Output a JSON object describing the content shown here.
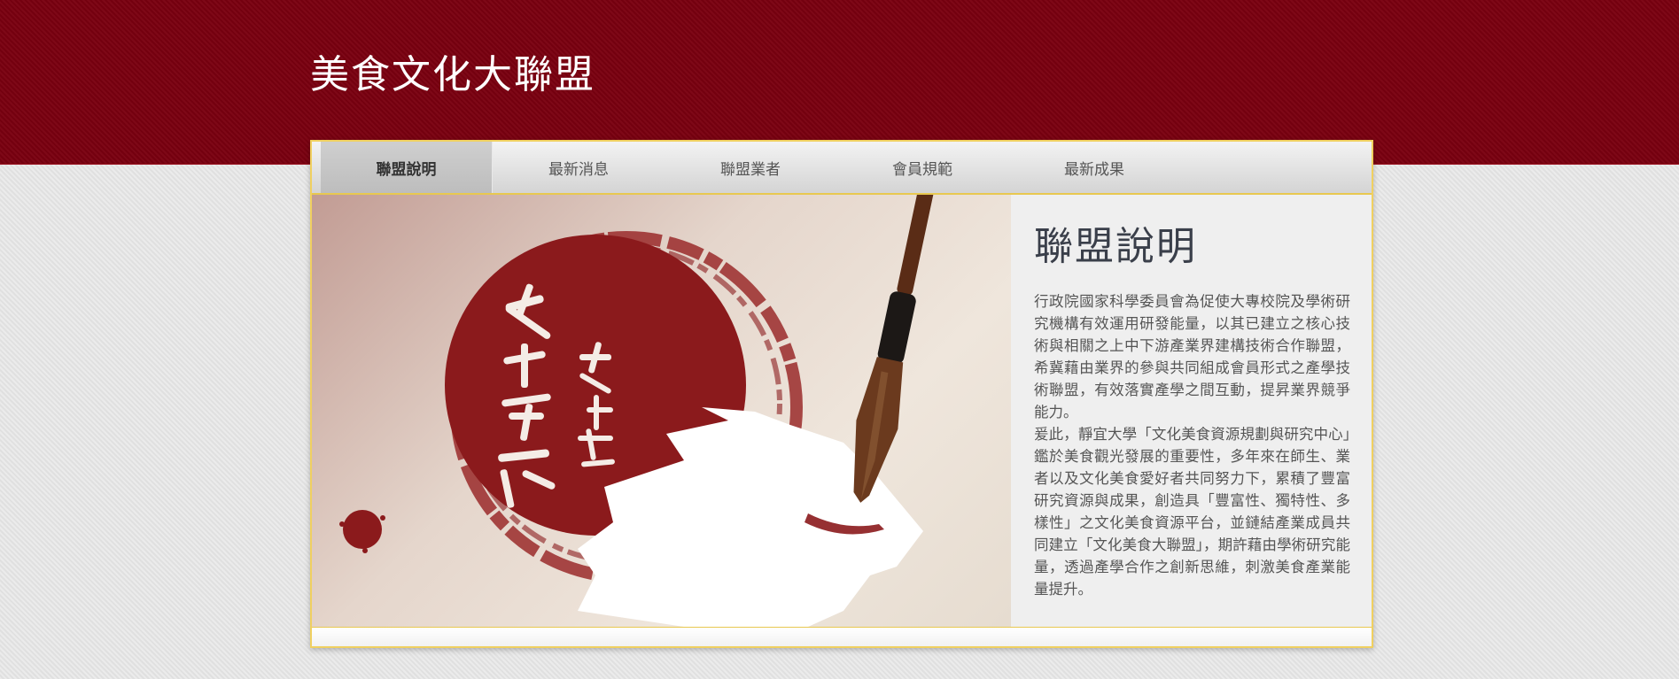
{
  "header": {
    "site_title": "美食文化大聯盟"
  },
  "nav": {
    "items": [
      {
        "label": "聯盟說明",
        "active": true
      },
      {
        "label": "最新消息",
        "active": false
      },
      {
        "label": "聯盟業者",
        "active": false
      },
      {
        "label": "會員規範",
        "active": false
      },
      {
        "label": "最新成果",
        "active": false
      }
    ]
  },
  "banner": {
    "calligraphy_text": "文化美食大聯盟",
    "colors": {
      "ink_red": "#8b1a1c",
      "paper": "#ece2d6"
    }
  },
  "content": {
    "heading": "聯盟說明",
    "paragraphs": [
      "行政院國家科學委員會為促使大專校院及學術研究機構有效運用研發能量，以其已建立之核心技術與相關之上中下游產業界建構技術合作聯盟，希冀藉由業界的參與共同組成會員形式之產學技術聯盟，有效落實產學之間互動，提昇業界競爭能力。",
      "爰此，靜宜大學「文化美食資源規劃與研究中心」鑑於美食觀光發展的重要性，多年來在師生、業者以及文化美食愛好者共同努力下，累積了豐富研究資源與成果，創造具「豐富性、獨特性、多樣性」之文化美食資源平台，並鏈結產業成員共同建立「文化美食大聯盟」，期許藉由學術研究能量，透過產學合作之創新思維，刺激美食產業能量提升。"
    ]
  },
  "theme": {
    "header_bg": "#7a0010",
    "accent_border": "#f0d060"
  }
}
